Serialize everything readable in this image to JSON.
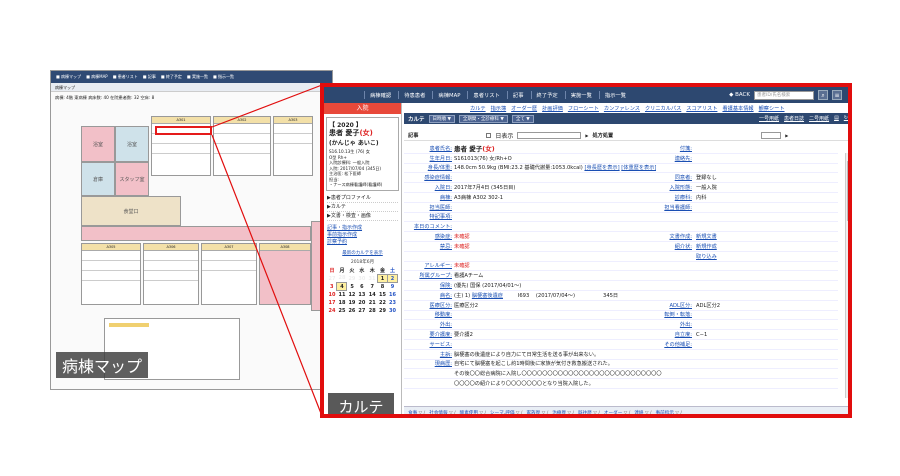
{
  "ward_map": {
    "nav_items": [
      "■ 病棟マップ",
      "■ 病棟MAP",
      "■ 患者リスト",
      "■ 記事",
      "■ 終了予定",
      "■ 実施一覧",
      "■ 指示一覧"
    ],
    "title": "病棟マップ",
    "info": "病棟: 4階 東病棟  病床数: 40  在院患者数: 32  空床: 8",
    "rooms": {
      "nurse_station": "スタッフ室",
      "toilet": "浴室",
      "bath": "浴室",
      "storage": "倉庫",
      "dayroom": "食堂口",
      "room_a": "A301",
      "room_b": "A302",
      "room_c": "A303",
      "room_d": "A305",
      "room_e": "A306",
      "room_f": "A307",
      "room_g": "A308"
    },
    "label": "病棟マップ"
  },
  "karte": {
    "nav": {
      "items": [
        "病棟確認",
        "待患患者",
        "病棟MAP",
        "患者リスト",
        "記事",
        "終了予定",
        "実施一覧",
        "指示一覧"
      ],
      "back": "◆ BACK",
      "search_placeholder": "患者ID/氏名検索"
    },
    "sidebar": {
      "admit_button": "入院",
      "year": "【 2020 】",
      "patient_name": "患者 愛子",
      "patient_sex": "(女)",
      "patient_kana": "(かんじゃ あいこ)",
      "details": [
        "S16.10.13生 (76)  女",
        "O型 Rh+",
        "入院診療科: 一般入院",
        "入院: 2017/07/04 (345日)",
        "主治医: 松下医師",
        "担当:",
        "・ナース病棟看護師(看護師)"
      ],
      "menu": [
        "▶患者プロファイル",
        "▶カルテ",
        "▶文書・検査・画像"
      ],
      "links": [
        "記事・指示作成",
        "事前指示作成",
        "診察予約"
      ],
      "cal_title": "最新のカルテを表示",
      "cal_month": "2018年6月",
      "cal_headers": [
        "日",
        "月",
        "火",
        "水",
        "木",
        "金",
        "土"
      ],
      "cal_rows": [
        [
          "27",
          "28",
          "29",
          "30",
          "31",
          "1",
          "2"
        ],
        [
          "3",
          "4",
          "5",
          "6",
          "7",
          "8",
          "9"
        ],
        [
          "10",
          "11",
          "12",
          "13",
          "14",
          "15",
          "16"
        ],
        [
          "17",
          "18",
          "19",
          "20",
          "21",
          "22",
          "23"
        ],
        [
          "24",
          "25",
          "26",
          "27",
          "28",
          "29",
          "30"
        ]
      ],
      "label": "カルテ"
    },
    "tabs": [
      "カルテ",
      "指示簿",
      "オーダー歴",
      "計画評価",
      "フローシート",
      "カンファレンス",
      "クリニカルパス",
      "スコアリスト",
      "看護基本情報",
      "観察シート"
    ],
    "header": {
      "title": "カルテ",
      "dd1": "日時順 ▼",
      "dd2": "全期間・全診療科 ▼",
      "dd3": "全て ▼",
      "right": [
        "一号用紙",
        "患者日誌",
        "二号用紙"
      ]
    },
    "subheader": {
      "label_left": "記事",
      "chk_label": "日表示",
      "label_right": "処方処置"
    },
    "rows": [
      {
        "k": "患者氏名:",
        "v": "患者 愛子",
        "vs": "(女)",
        "k2": "付箋:",
        "v2": ""
      },
      {
        "k": "生年月日:",
        "v": "S161013(76)  女/Rh+O",
        "k2": "連絡先:",
        "v2": ""
      },
      {
        "k": "身長/体重:",
        "v": "148.0cm 50.9kg (BMI:23.2  基礎代謝量:1053.0kcal)",
        "vl": "[身長歴を表示]",
        "vl2": "[体重歴を表示]",
        "k2": "",
        "v2": ""
      },
      {
        "k": "感染症情報:",
        "v": "",
        "k2": "同意者:",
        "v2": "登録なし"
      },
      {
        "k": "入院日:",
        "v": "2017年7月4日 (345日目)",
        "k2": "入院形態:",
        "v2": "一般入院"
      },
      {
        "k": "病棟:",
        "v": "A3病棟  A302  302-1",
        "k2": "診療科:",
        "v2": "内科"
      },
      {
        "k": "担当医師:",
        "v": "",
        "k2": "担当看護師:",
        "v2": ""
      },
      {
        "k": "特記事項:",
        "v": "",
        "k2": "",
        "v2": ""
      },
      {
        "k": "本日のコメント:",
        "v": "",
        "k2": "",
        "v2": ""
      },
      {
        "k": "感染症:",
        "v": "未確認",
        "red": true,
        "k2": "文書作成:",
        "v2": "新規文書",
        "v2link": true
      },
      {
        "k": "禁忌:",
        "v": "未確認",
        "red": true,
        "k2": "紹介状:",
        "v2": "新規作成",
        "v2link": true
      },
      {
        "k": "",
        "v": "",
        "k2": "",
        "v2": "取り込み",
        "v2link": true
      },
      {
        "k": "アレルギー:",
        "v": "未確認",
        "red": true,
        "k2": "",
        "v2": ""
      },
      {
        "k": "所属グループ:",
        "v": "看護Aチーム",
        "k2": "",
        "v2": ""
      },
      {
        "k": "保険:",
        "v": "(優先) 国保 (2017/04/01〜)",
        "k2": "",
        "v2": ""
      },
      {
        "k": "病名:",
        "v": "(主)  1) ",
        "vl": "脳梗塞後遺症",
        "vtail": "         I693    (2017/07/04〜)                 345日",
        "k2": "",
        "v2": ""
      },
      {
        "k": "医療区分:",
        "v": "医療区分2",
        "k2": "ADL区分:",
        "v2": "ADL区分2"
      },
      {
        "k": "移動度:",
        "v": "",
        "k2": "転倒・転落:",
        "v2": ""
      },
      {
        "k": "外出:",
        "v": "",
        "k2": "外出:",
        "v2": ""
      },
      {
        "k": "要介護度:",
        "v": "要介護2",
        "k2": "自立度:",
        "v2": "C−1"
      },
      {
        "k": "サービス:",
        "v": "",
        "k2": "その他補足:",
        "v2": ""
      },
      {
        "k": "主訴:",
        "v": "脳梗塞の後遺症により自力にて日常生活を送る事が出来ない。",
        "k2": "",
        "v2": ""
      },
      {
        "k": "現病歴:",
        "v": "自宅にて脳梗塞を起こし約1時間後に家族が気付き救急搬送された。",
        "k2": "",
        "v2": ""
      },
      {
        "k": "",
        "v": "その後〇〇総合病院に入院し〇〇〇〇〇〇〇〇〇〇〇〇〇〇〇〇〇〇〇〇〇〇〇〇〇〇〇",
        "k2": "",
        "v2": ""
      },
      {
        "k": "",
        "v": "〇〇〇〇の紹介により〇〇〇〇〇〇〇となり当院入院した。",
        "k2": "",
        "v2": ""
      }
    ],
    "bottom": [
      "食事",
      "社会情報",
      "酸素使用",
      "シーマ,評価",
      "家族歴",
      "治療歴",
      "既往歴",
      "オーダー",
      "連絡",
      "事前指示"
    ]
  }
}
